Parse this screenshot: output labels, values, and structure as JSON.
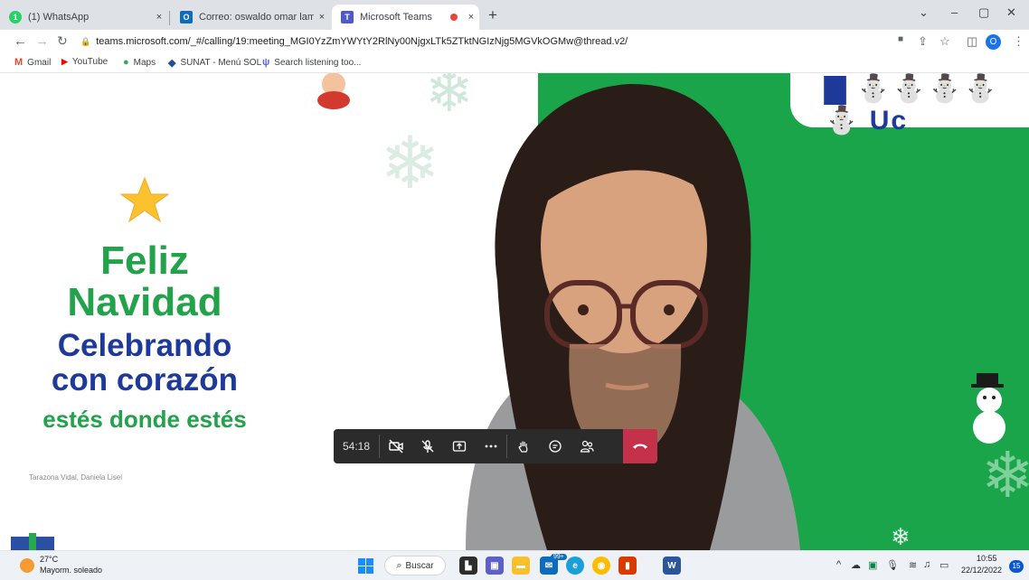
{
  "browser": {
    "tabs": [
      {
        "title": "(1) WhatsApp",
        "close": "×"
      },
      {
        "title": "Correo: oswaldo omar lamas rios",
        "close": "×"
      },
      {
        "title": "Microsoft Teams",
        "close": "×"
      }
    ],
    "new_tab": "+",
    "window_controls": {
      "minimize": "–",
      "maximize": "▢",
      "close": "✕",
      "dropdown": "⌄"
    },
    "url": "teams.microsoft.com/_#/calling/19:meeting_MGI0YzZmYWYtY2RlNy00NjgxLTk5ZTktNGIzNjg5MGVkOGMw@thread.v2/",
    "profile_initial": "O",
    "bookmarks": [
      {
        "label": "Gmail",
        "icon": "M",
        "color": "#ea4335"
      },
      {
        "label": "YouTube",
        "icon": "▶",
        "color": "#ff0000"
      },
      {
        "label": "Maps",
        "icon": "●",
        "color": "#34a853"
      },
      {
        "label": "SUNAT - Menú SOL",
        "icon": "◆",
        "color": "#1b4f9c"
      },
      {
        "label": "Search listening too...",
        "icon": "ψ",
        "color": "#5b6bd6"
      }
    ]
  },
  "meeting": {
    "greeting": {
      "line1": "Feliz",
      "line2": "Navidad",
      "line3": "Celebrando",
      "line4": "con corazón",
      "line5": "estés donde estés"
    },
    "presenter_name": "Tarazona Vidal, Daniela Lisei",
    "timer": "54:18",
    "colors": {
      "green": "#1aa54a",
      "blue": "#1d3a9b",
      "hangup": "#c4314b"
    }
  },
  "taskbar": {
    "weather_temp": "27°C",
    "weather_desc": "Mayorm. soleado",
    "search_label": "Buscar",
    "mail_badge": "99+",
    "clock_time": "10:55",
    "clock_date": "22/12/2022",
    "notification_count": "15"
  }
}
